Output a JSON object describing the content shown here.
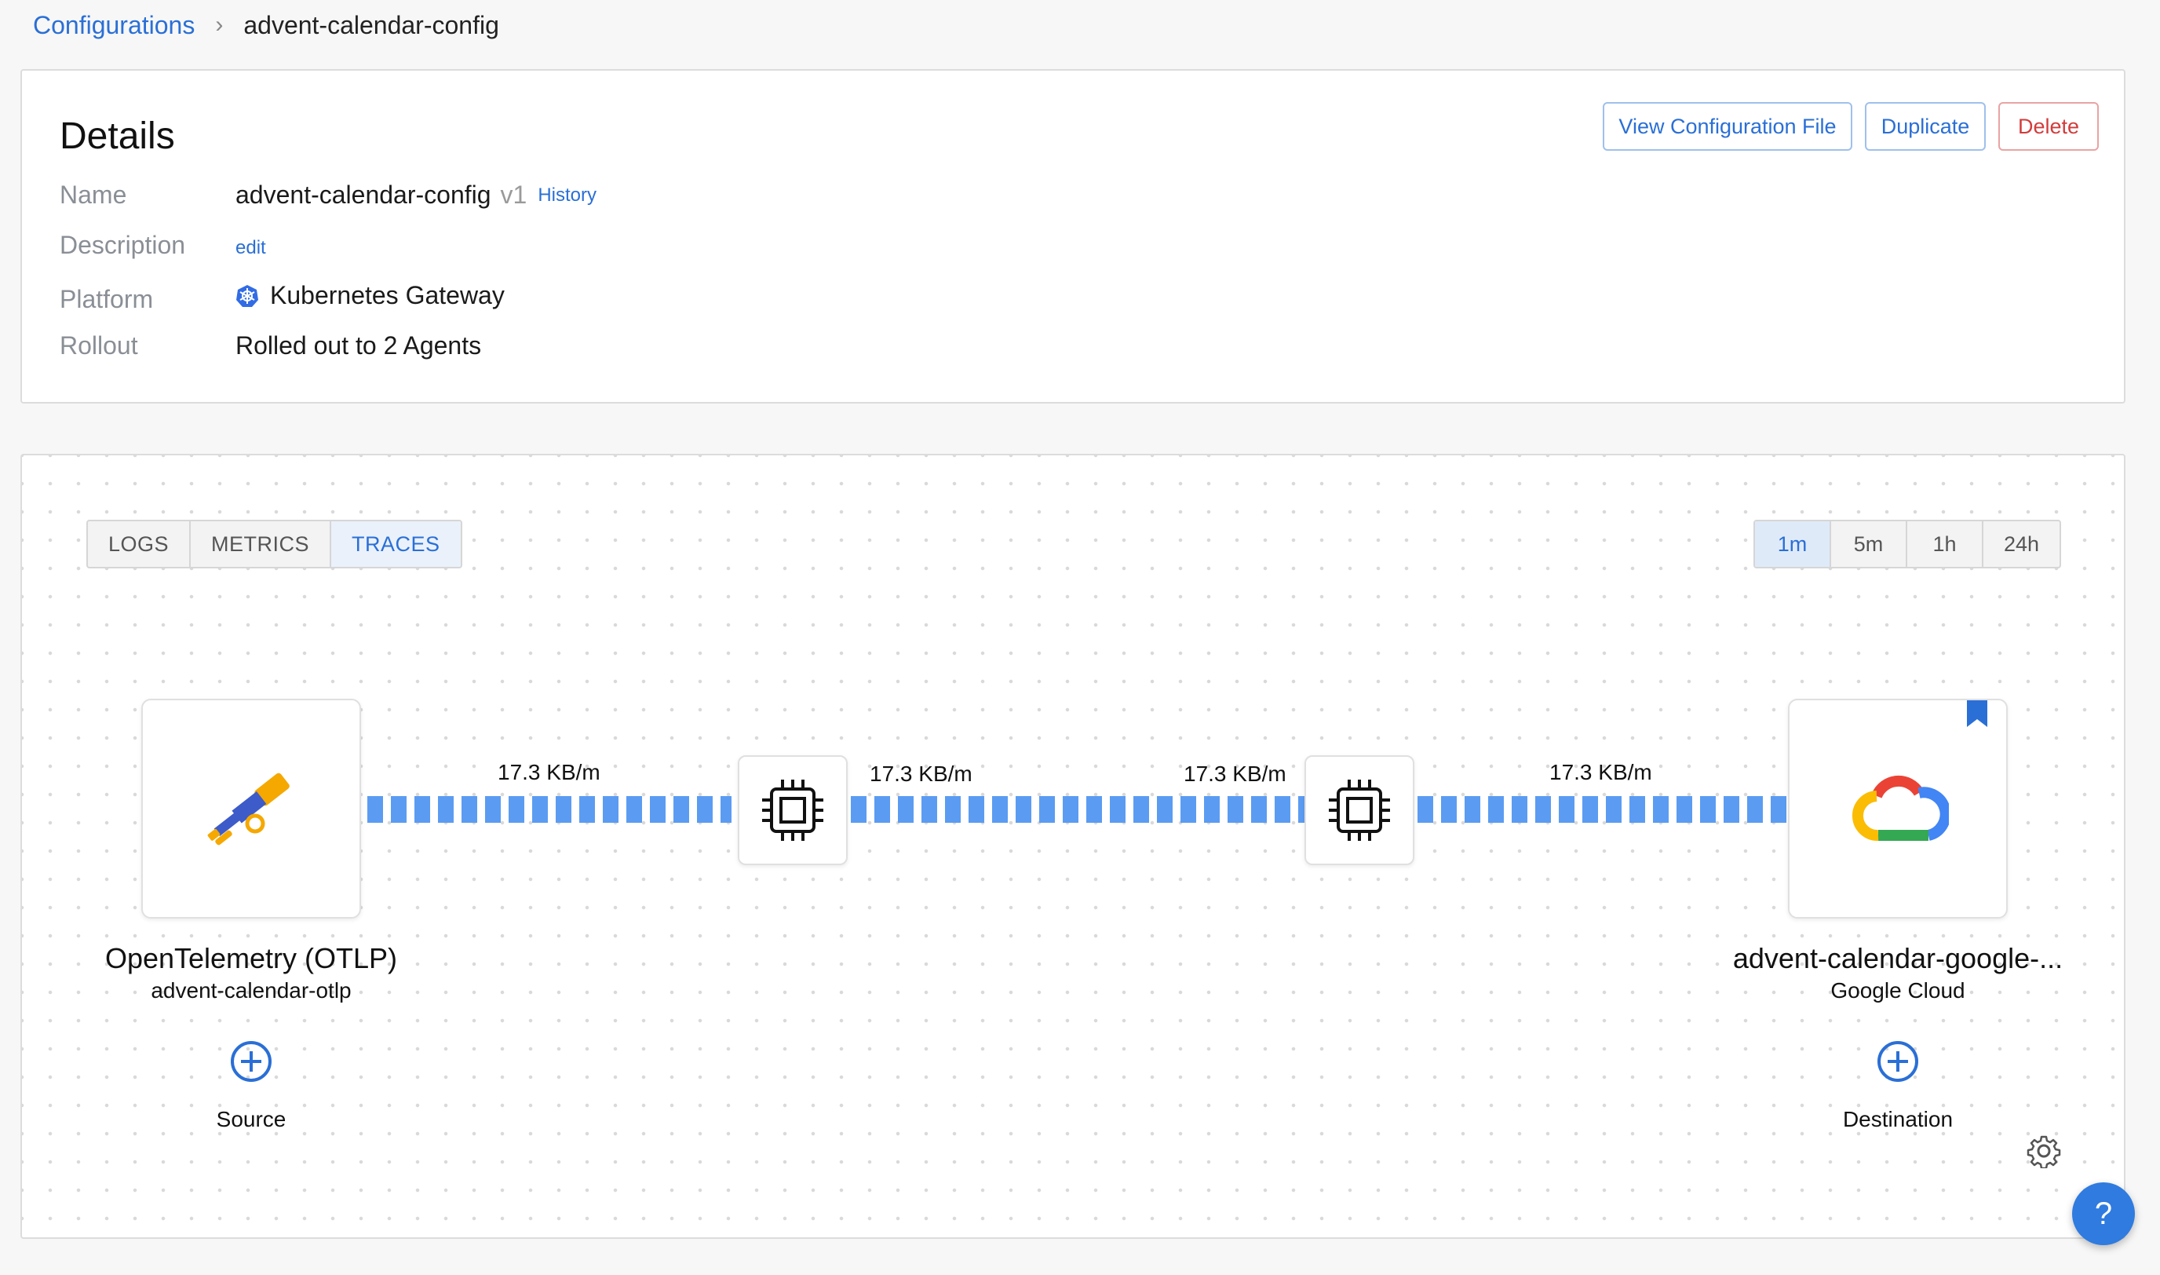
{
  "breadcrumb": {
    "root": "Configurations",
    "separator": "›",
    "current": "advent-calendar-config"
  },
  "details": {
    "title": "Details",
    "buttons": {
      "view_config": "View Configuration File",
      "duplicate": "Duplicate",
      "delete": "Delete"
    },
    "rows": {
      "name_label": "Name",
      "name_value": "advent-calendar-config",
      "version": "v1",
      "history_link": "History",
      "description_label": "Description",
      "description_edit": "edit",
      "platform_label": "Platform",
      "platform_value": "Kubernetes Gateway",
      "rollout_label": "Rollout",
      "rollout_value": "Rolled out to 2 Agents"
    }
  },
  "graph": {
    "tabs": [
      "LOGS",
      "METRICS",
      "TRACES"
    ],
    "active_tab": "TRACES",
    "periods": [
      "1m",
      "5m",
      "1h",
      "24h"
    ],
    "active_period": "1m",
    "rates": [
      "17.3 KB/m",
      "17.3 KB/m",
      "17.3 KB/m",
      "17.3 KB/m"
    ],
    "source": {
      "title": "OpenTelemetry (OTLP)",
      "name": "advent-calendar-otlp",
      "icon": "telescope-icon"
    },
    "destination": {
      "title": "advent-calendar-google-...",
      "name": "Google Cloud",
      "icon": "google-cloud-icon"
    },
    "processor_icon": "processor-chip-icon",
    "add_source_label": "Source",
    "add_destination_label": "Destination",
    "help_label": "?"
  },
  "colors": {
    "accent": "#2a6fd6",
    "edge": "#5b9cf2",
    "danger": "#d23c3c"
  }
}
